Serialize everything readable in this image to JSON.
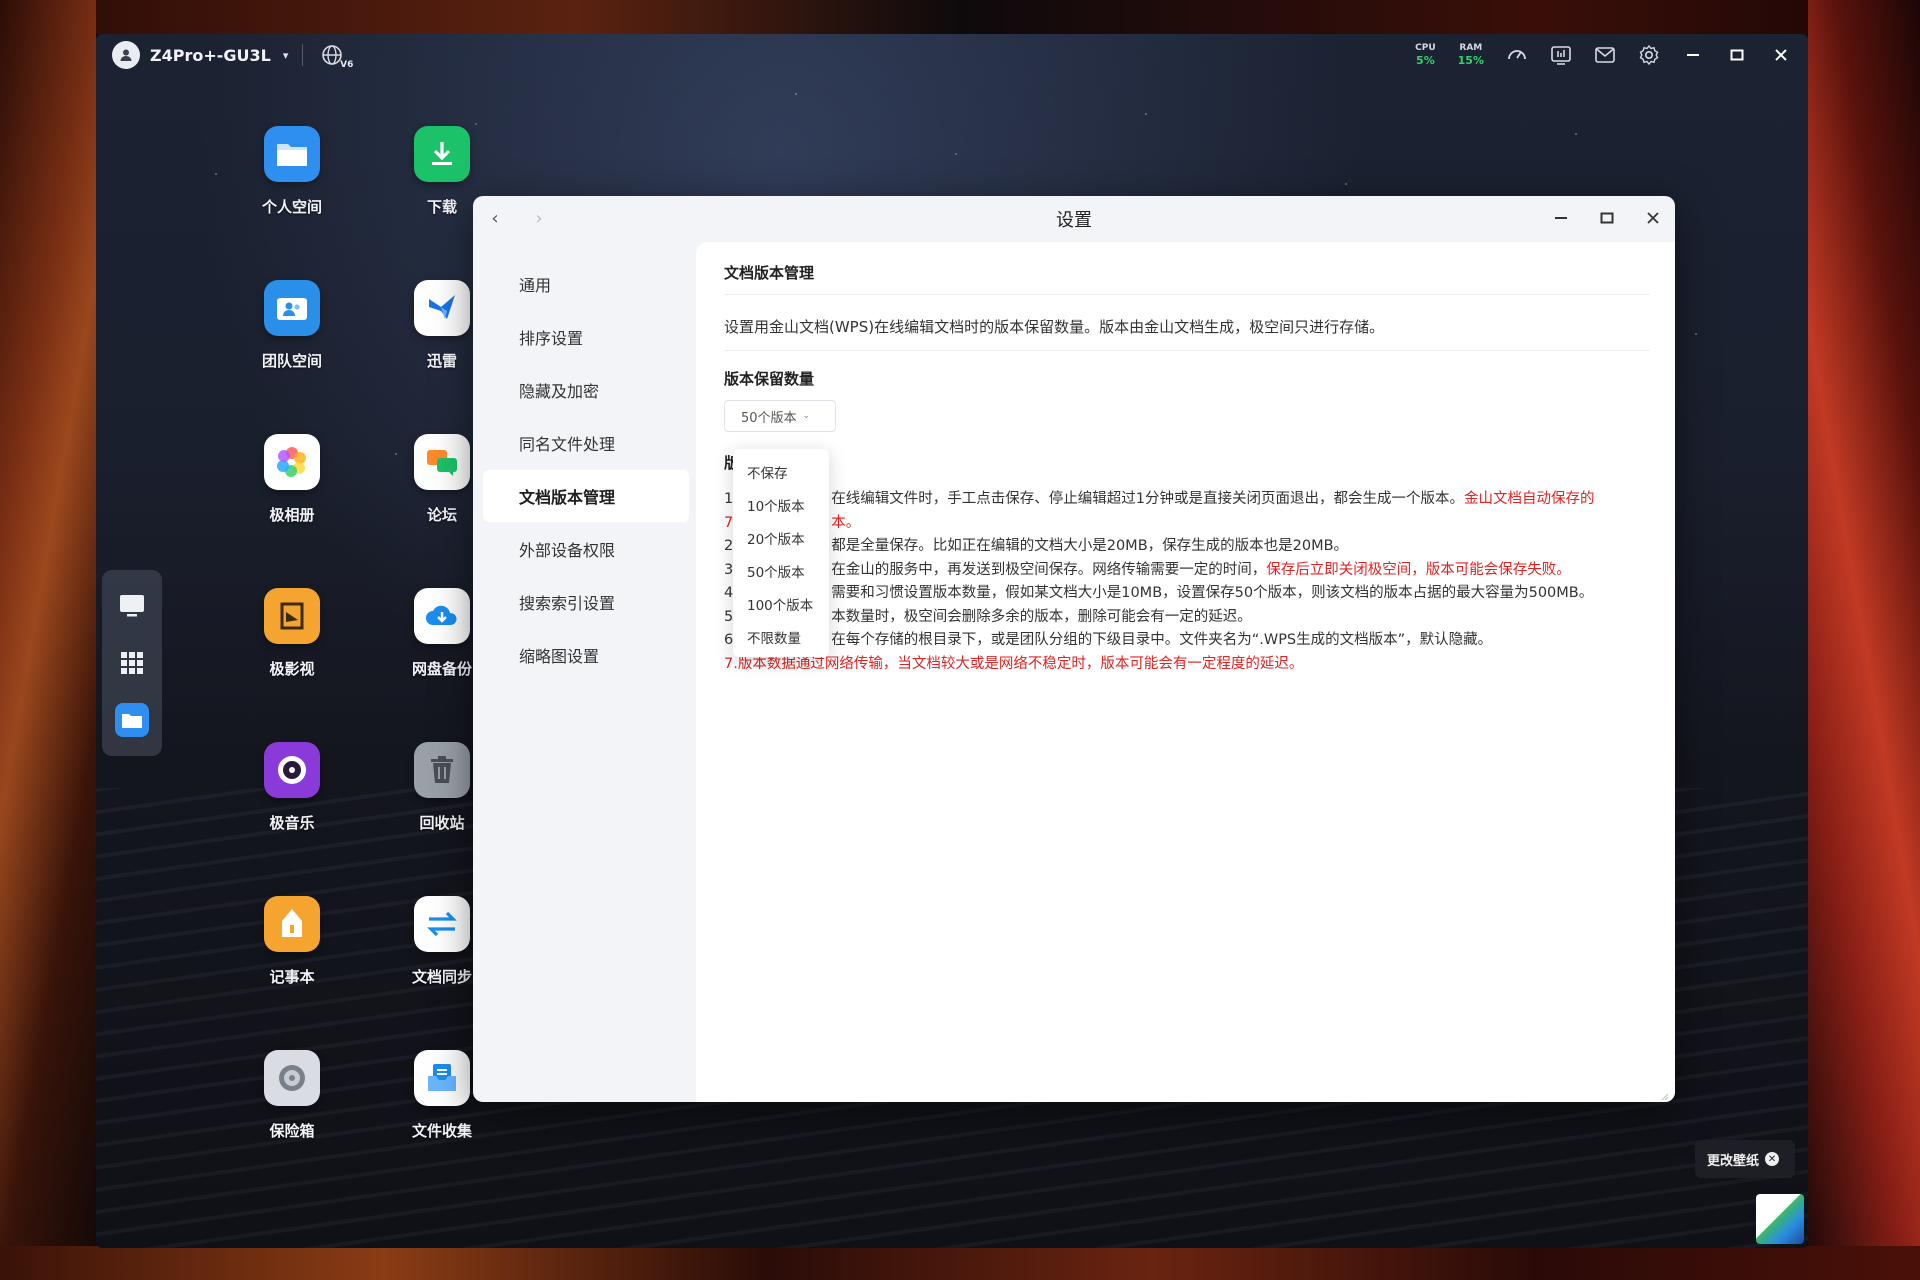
{
  "topbar": {
    "device_name": "Z4Pro+-GU3L",
    "net_badge": "V6",
    "cpu_label": "CPU",
    "cpu_value": "5%",
    "ram_label": "RAM",
    "ram_value": "15%"
  },
  "desktop_icons": [
    {
      "label": "个人空间",
      "color": "#2f8ff0"
    },
    {
      "label": "下载",
      "color": "#1cc26a"
    },
    {
      "label": "团队空间",
      "color": "#2a8fe8"
    },
    {
      "label": "迅雷",
      "color": "#ffffff"
    },
    {
      "label": "极相册",
      "color": "#ffffff"
    },
    {
      "label": "论坛",
      "color": "#ffffff"
    },
    {
      "label": "极影视",
      "color": "#f6a430"
    },
    {
      "label": "网盘备份",
      "color": "#ffffff"
    },
    {
      "label": "极音乐",
      "color": "#8a3ad8"
    },
    {
      "label": "回收站",
      "color": "#9aa0a8"
    },
    {
      "label": "记事本",
      "color": "#f6a430"
    },
    {
      "label": "文档同步",
      "color": "#ffffff"
    },
    {
      "label": "保险箱",
      "color": "#d9dde3"
    },
    {
      "label": "文件收集",
      "color": "#ffffff"
    }
  ],
  "window": {
    "title": "设置",
    "sidebar": [
      {
        "label": "通用"
      },
      {
        "label": "排序设置"
      },
      {
        "label": "隐藏及加密"
      },
      {
        "label": "同名文件处理"
      },
      {
        "label": "文档版本管理"
      },
      {
        "label": "外部设备权限"
      },
      {
        "label": "搜索索引设置"
      },
      {
        "label": "缩略图设置"
      }
    ],
    "content": {
      "section_title": "文档版本管理",
      "description": "设置用金山文档(WPS)在线编辑文档时的版本保留数量。版本由金山文档生成，极空间只进行存储。",
      "field_label": "版本保留数量",
      "selected_value": "50个版本",
      "notes_title_partial": "版",
      "notes": {
        "n1_num": "1",
        "n1_text": "在线编辑文件时，手工点击保存、停止编辑超过1分钟或是直接关闭页面退出，都会生成一个版本。",
        "n1_red": "金山文档自动保存的",
        "n1b_red_prefix": "7",
        "n1b_red": "本。",
        "n2_num": "2",
        "n2_text": "都是全量保存。比如正在编辑的文档大小是20MB，保存生成的版本也是20MB。",
        "n3_num": "3",
        "n3_text": "在金山的服务中，再发送到极空间保存。网络传输需要一定的时间，",
        "n3_red": "保存后立即关闭极空间，版本可能会保存失败。",
        "n4_num": "4",
        "n4_text": "需要和习惯设置版本数量，假如某文档大小是10MB，设置保存50个版本，则该文档的版本占据的最大容量为500MB。",
        "n5_num": "5",
        "n5_text": "本数量时，极空间会删除多余的版本，删除可能会有一定的延迟。",
        "n6_num": "6",
        "n6_text": "在每个存储的根目录下，或是团队分组的下级目录中。文件夹名为“.WPS生成的文档版本”，默认隐藏。",
        "n7_num": "7.",
        "n7_red": "版本数据通过网络传输，当文档较大或是网络不稳定时，版本可能会有一定程度的延迟。"
      },
      "dropdown_options": [
        "不保存",
        "10个版本",
        "20个版本",
        "50个版本",
        "100个版本",
        "不限数量"
      ]
    }
  },
  "wallpaper_toast": {
    "label": "更改壁纸"
  }
}
